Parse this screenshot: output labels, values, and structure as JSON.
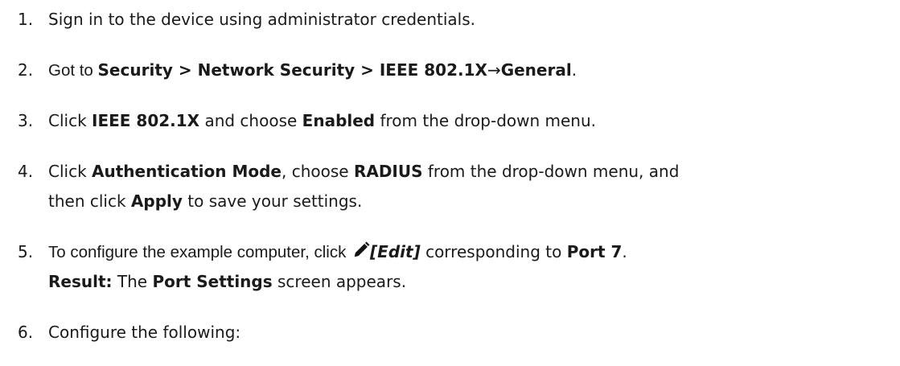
{
  "steps": [
    {
      "number": "1.",
      "text": "Sign in to the device using administrator credentials."
    },
    {
      "number": "2.",
      "prefix": "Got to ",
      "path": "Security > Network Security > IEEE 802.1X",
      "arrow": "→",
      "tab": "General",
      "suffix": "."
    },
    {
      "number": "3.",
      "t1": "Click ",
      "b1": "IEEE 802.1X",
      "t2": " and choose ",
      "b2": "Enabled",
      "t3": " from the drop-down menu."
    },
    {
      "number": "4.",
      "t1": "Click ",
      "b1": "Authentication Mode",
      "t2": ", choose ",
      "b2": "RADIUS",
      "t3": " from the drop-down menu, and",
      "l2_t1": "then click ",
      "l2_b1": "Apply",
      "l2_t2": " to save your settings."
    },
    {
      "number": "5.",
      "t1": "To configure the example computer, click ",
      "icon": "pencil-edit-icon",
      "edit": "[Edit]",
      "t2": " corresponding to ",
      "b1": "Port 7",
      "t3": ".",
      "l2_b1": "Result:",
      "l2_t1": " The ",
      "l2_b2": "Port Settings",
      "l2_t2": " screen appears."
    },
    {
      "number": "6.",
      "text": "Configure the following:"
    }
  ]
}
